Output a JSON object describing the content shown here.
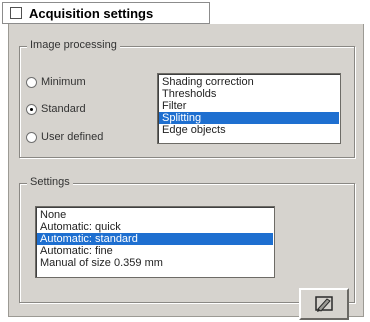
{
  "window": {
    "title": "Acquisition settings"
  },
  "image_processing": {
    "legend": "Image processing",
    "radios": [
      {
        "label": "Minimum",
        "selected": false
      },
      {
        "label": "Standard",
        "selected": true
      },
      {
        "label": "User defined",
        "selected": false
      }
    ],
    "list": [
      {
        "label": "Shading correction",
        "selected": false
      },
      {
        "label": "Thresholds",
        "selected": false
      },
      {
        "label": "Filter",
        "selected": false
      },
      {
        "label": "Splitting",
        "selected": true
      },
      {
        "label": "Edge objects",
        "selected": false
      }
    ]
  },
  "settings": {
    "legend": "Settings",
    "list": [
      {
        "label": "None",
        "selected": false
      },
      {
        "label": "Automatic: quick",
        "selected": false
      },
      {
        "label": "Automatic: standard",
        "selected": true
      },
      {
        "label": "Automatic: fine",
        "selected": false
      },
      {
        "label": "Manual of size 0.359 mm",
        "selected": false
      }
    ],
    "edit_button_icon": "pencil-edit-icon"
  },
  "colors": {
    "selection": "#1e6fd0",
    "panel": "#d6d3ce"
  }
}
